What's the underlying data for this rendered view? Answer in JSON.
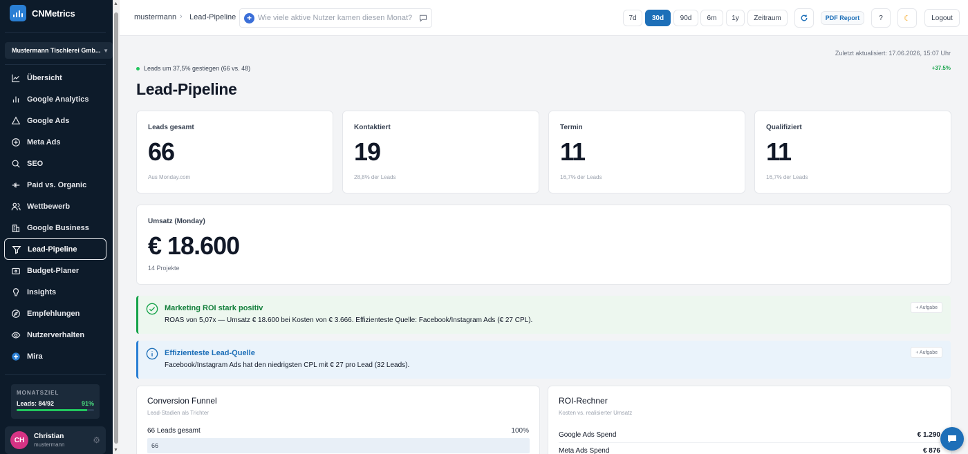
{
  "brand": {
    "name": "CNMetrics"
  },
  "sidebar": {
    "org": "Mustermann Tischlerei Gmb...",
    "items": [
      {
        "label": "Übersicht",
        "icon": "line-chart-icon"
      },
      {
        "label": "Google Analytics",
        "icon": "bar-chart-icon"
      },
      {
        "label": "Google Ads",
        "icon": "triangle-icon"
      },
      {
        "label": "Meta Ads",
        "icon": "plus-circle-icon"
      },
      {
        "label": "SEO",
        "icon": "search-icon"
      },
      {
        "label": "Paid vs. Organic",
        "icon": "split-icon"
      },
      {
        "label": "Wettbewerb",
        "icon": "users-icon"
      },
      {
        "label": "Google Business",
        "icon": "building-icon"
      },
      {
        "label": "Lead-Pipeline",
        "icon": "funnel-icon"
      },
      {
        "label": "Budget-Planer",
        "icon": "wallet-icon"
      },
      {
        "label": "Insights",
        "icon": "lightbulb-icon"
      },
      {
        "label": "Empfehlungen",
        "icon": "compass-icon"
      },
      {
        "label": "Nutzerverhalten",
        "icon": "eye-icon"
      },
      {
        "label": "Mira",
        "icon": "mira-icon"
      }
    ],
    "goal": {
      "title": "MONATSZIEL",
      "leads": "Leads: 84/92",
      "pct": "91%",
      "fraction": 0.91
    },
    "user": {
      "initials": "CH",
      "name": "Christian",
      "handle": "mustermann"
    }
  },
  "topbar": {
    "breadcrumb": [
      "mustermann",
      "Lead-Pipeline"
    ],
    "search_placeholder": "Wie viele aktive Nutzer kamen diesen Monat?",
    "ranges": [
      "7d",
      "30d",
      "90d",
      "6m",
      "1y",
      "Zeitraum"
    ],
    "active_range": "30d",
    "report": "PDF Report",
    "help": "?",
    "logout": "Logout"
  },
  "main": {
    "updated": "Zuletzt aktualisiert: 17.06.2026, 15:07 Uhr",
    "trend": "Leads um 37,5% gestiegen (66 vs. 48)",
    "trend_delta": "+37.5%",
    "title": "Lead-Pipeline",
    "kpis": [
      {
        "label": "Leads gesamt",
        "value": "66",
        "sub": "Aus Monday.com"
      },
      {
        "label": "Kontaktiert",
        "value": "19",
        "sub": "28,8% der Leads"
      },
      {
        "label": "Termin",
        "value": "11",
        "sub": "16,7% der Leads"
      },
      {
        "label": "Qualifiziert",
        "value": "11",
        "sub": "16,7% der Leads"
      }
    ],
    "revenue": {
      "label": "Umsatz (Monday)",
      "value": "€ 18.600",
      "sub": "14 Projekte"
    },
    "insights": [
      {
        "title": "Marketing ROI stark positiv",
        "text": "ROAS von 5,07x — Umsatz € 18.600 bei Kosten von € 3.666. Effizienteste Quelle: Facebook/Instagram Ads (€ 27 CPL).",
        "task": "+ Aufgabe"
      },
      {
        "title": "Effizienteste Lead-Quelle",
        "text": "Facebook/Instagram Ads hat den niedrigsten CPL mit € 27 pro Lead (32 Leads).",
        "task": "+ Aufgabe"
      }
    ],
    "funnel": {
      "title": "Conversion Funnel",
      "subtitle": "Lead-Stadien als Trichter",
      "row_label": "66 Leads gesamt",
      "row_pct": "100%",
      "row_value": "66"
    },
    "roi": {
      "title": "ROI-Rechner",
      "subtitle": "Kosten vs. realisierter Umsatz",
      "rows": [
        {
          "label": "Google Ads Spend",
          "value": "€ 1.290"
        },
        {
          "label": "Meta Ads Spend",
          "value": "€ 876"
        }
      ]
    }
  }
}
